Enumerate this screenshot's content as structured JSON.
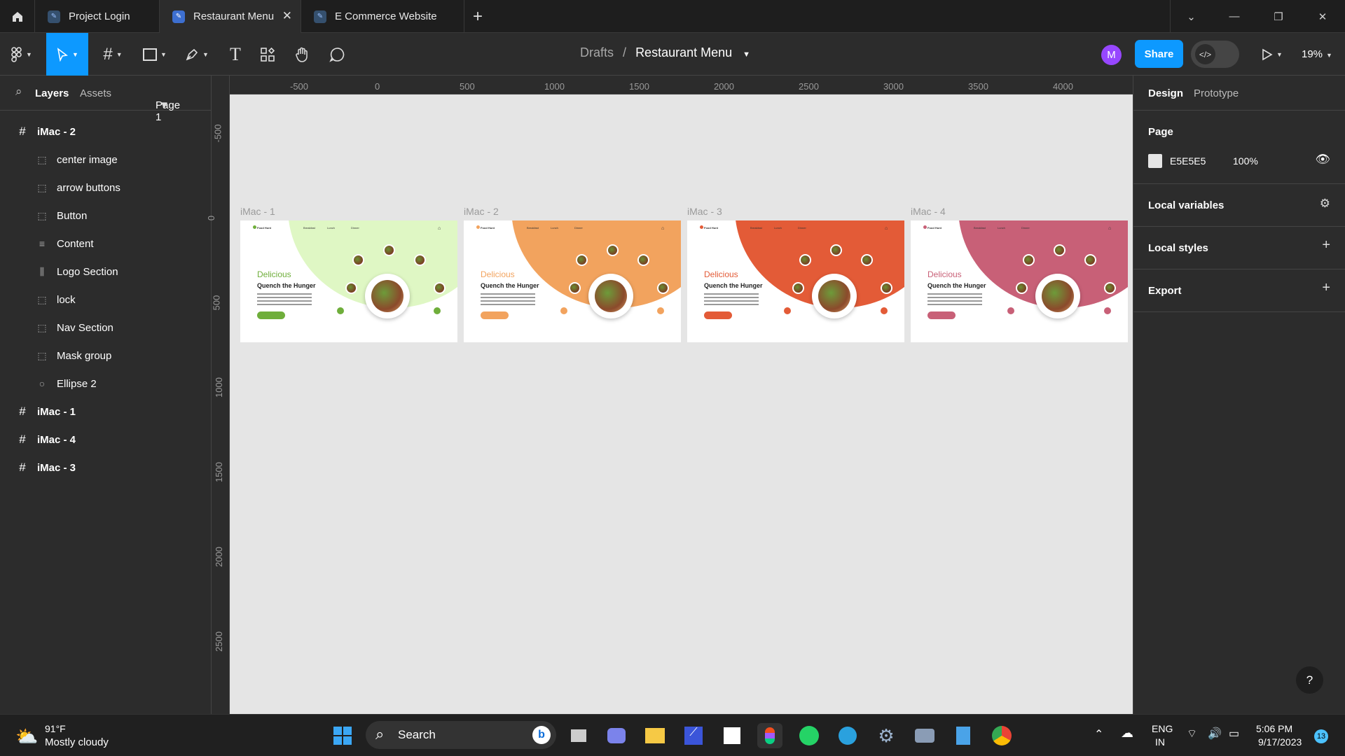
{
  "tabs": [
    {
      "label": "Project Login"
    },
    {
      "label": "Restaurant Menu"
    },
    {
      "label": "E Commerce Website"
    }
  ],
  "breadcrumb": {
    "parent": "Drafts",
    "separator": "/",
    "file": "Restaurant Menu"
  },
  "toolbar": {
    "share": "Share",
    "avatar": "M",
    "zoom": "19%"
  },
  "left_panel": {
    "tab_layers": "Layers",
    "tab_assets": "Assets",
    "page": "Page 1",
    "layers": [
      {
        "label": "iMac - 2",
        "icon": "frame-icon",
        "level": 0
      },
      {
        "label": "center image",
        "icon": "image-icon",
        "level": 1
      },
      {
        "label": "arrow buttons",
        "icon": "group-icon",
        "level": 1
      },
      {
        "label": "Button",
        "icon": "group-icon",
        "level": 1
      },
      {
        "label": "Content",
        "icon": "text-lines-icon",
        "level": 1
      },
      {
        "label": "Logo Section",
        "icon": "auto-layout-icon",
        "level": 1
      },
      {
        "label": "lock",
        "icon": "group-icon",
        "level": 1
      },
      {
        "label": "Nav Section",
        "icon": "group-icon",
        "level": 1
      },
      {
        "label": "Mask group",
        "icon": "group-icon",
        "level": 1
      },
      {
        "label": "Ellipse 2",
        "icon": "ellipse-icon",
        "level": 1
      },
      {
        "label": "iMac - 1",
        "icon": "frame-icon",
        "level": 0
      },
      {
        "label": "iMac - 4",
        "icon": "frame-icon",
        "level": 0
      },
      {
        "label": "iMac - 3",
        "icon": "frame-icon",
        "level": 0
      }
    ]
  },
  "right_panel": {
    "tab_design": "Design",
    "tab_prototype": "Prototype",
    "page_title": "Page",
    "page_color": "E5E5E5",
    "page_opacity": "100%",
    "local_variables": "Local variables",
    "local_styles": "Local styles",
    "export": "Export"
  },
  "rulers": {
    "h": [
      "-500",
      "0",
      "500",
      "1000",
      "1500",
      "2000",
      "2500",
      "3000",
      "3500",
      "4000"
    ],
    "v": [
      "-500",
      "0",
      "500",
      "1000",
      "1500",
      "2000",
      "2500"
    ]
  },
  "frames": [
    {
      "label": "iMac - 1",
      "color": "#dff7c4",
      "accent": "#6fae3b"
    },
    {
      "label": "iMac - 2",
      "color": "#f2a35e",
      "accent": "#f2a35e"
    },
    {
      "label": "iMac - 3",
      "color": "#e35b37",
      "accent": "#e35b37"
    },
    {
      "label": "iMac - 4",
      "color": "#c86077",
      "accent": "#c86077"
    }
  ],
  "frame_content": {
    "logo": "Food Hunt",
    "nav": [
      "Breakfast",
      "Lunch",
      "Dinner"
    ],
    "headline": "Delicious",
    "subheadline": "Quench the Hunger"
  },
  "taskbar": {
    "temp": "91°F",
    "weather": "Mostly cloudy",
    "search": "Search",
    "lang": "ENG",
    "region": "IN",
    "time": "5:06 PM",
    "date": "9/17/2023",
    "badge": "13"
  }
}
